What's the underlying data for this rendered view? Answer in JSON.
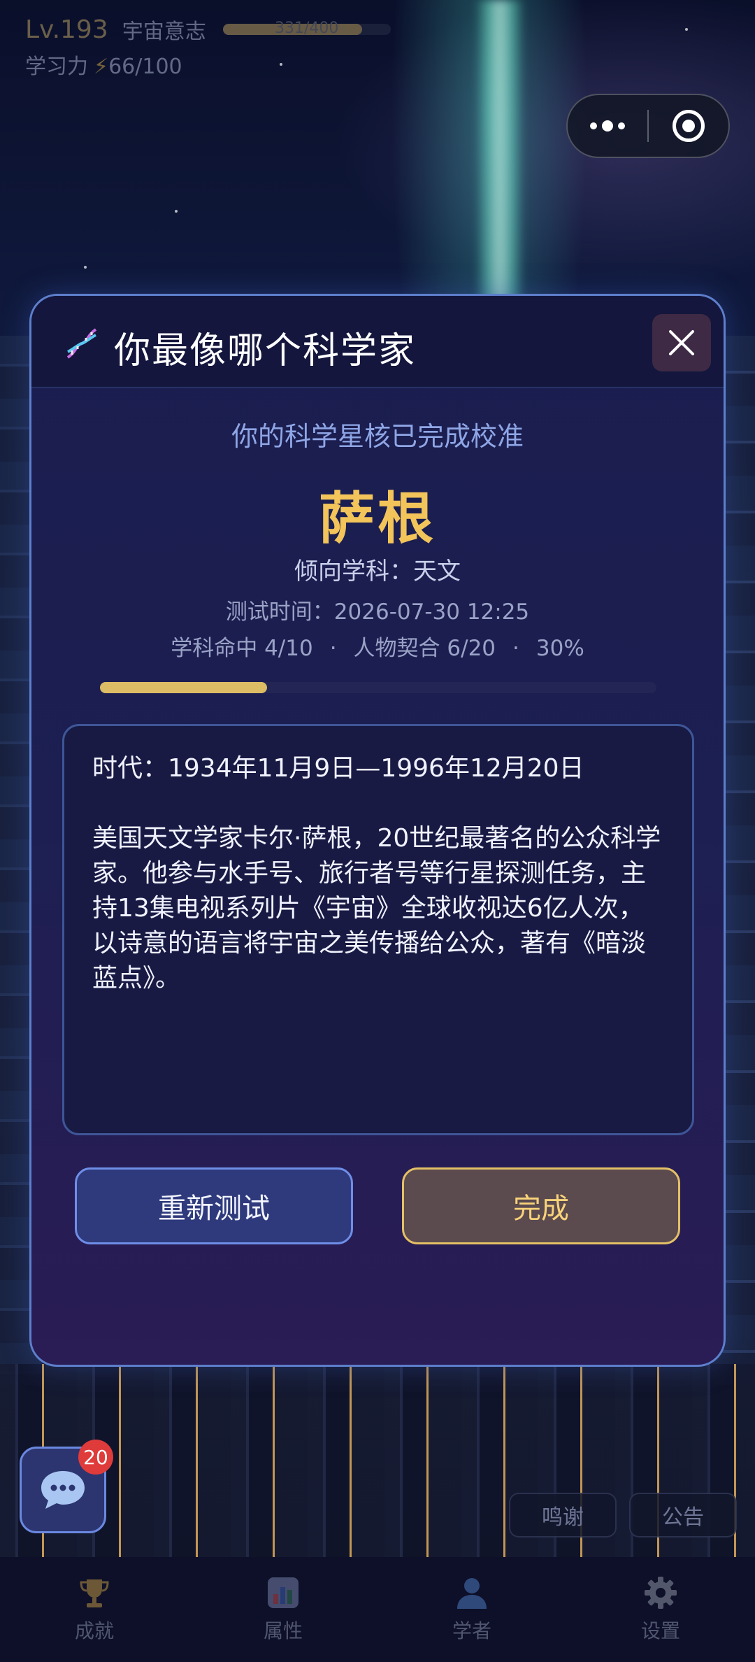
{
  "hud": {
    "level": "Lv.193",
    "title": "宇宙意志",
    "xp_text": "331/400",
    "xp_fraction": 0.83,
    "energy_label": "学习力",
    "energy_icon": "lightning-icon",
    "energy_value": "66/100"
  },
  "capsule": {
    "more_icon": "more-dots-icon",
    "close_icon": "target-circle-icon"
  },
  "modal": {
    "title": "你最像哪个科学家",
    "title_icon": "dna-icon",
    "subtitle": "你的科学星核已完成校准",
    "result_name": "萨根",
    "subject": "倾向学科：天文",
    "test_time": "测试时间：2026-07-30 12:25",
    "stats": {
      "subject_hit": "学科命中 4/10",
      "person_fit": "人物契合 6/20",
      "percent": "30%",
      "separator": "·"
    },
    "progress_fraction": 0.3,
    "era": "时代：1934年11月9日—1996年12月20日",
    "description": "美国天文学家卡尔·萨根，20世纪最著名的公众科学家。他参与水手号、旅行者号等行星探测任务，主持13集电视系列片《宇宙》全球收视达6亿人次，以诗意的语言将宇宙之美传播给公众，著有《暗淡蓝点》。",
    "retry_label": "重新测试",
    "done_label": "完成"
  },
  "chat": {
    "badge": "20"
  },
  "side_buttons": {
    "thanks": "鸣谢",
    "notice": "公告"
  },
  "nav": {
    "items": [
      {
        "label": "成就",
        "icon": "trophy-icon"
      },
      {
        "label": "属性",
        "icon": "bar-chart-icon"
      },
      {
        "label": "学者",
        "icon": "person-icon"
      },
      {
        "label": "设置",
        "icon": "gear-icon"
      }
    ]
  },
  "colors": {
    "accent_gold": "#f2c45a",
    "accent_blue": "#6f8ee8",
    "badge_red": "#e03b3b"
  }
}
